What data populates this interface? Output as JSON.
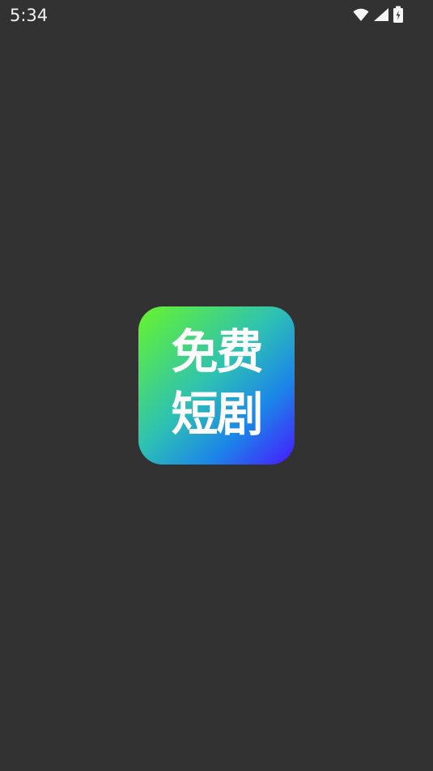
{
  "status_bar": {
    "time": "5:34",
    "icons": [
      "wifi-icon",
      "signal-icon",
      "battery-icon"
    ]
  },
  "app": {
    "icon_line_1": "免费",
    "icon_line_2": "短剧"
  },
  "colors": {
    "background": "#323232",
    "status_text": "#f2f2f2",
    "gradient": [
      "#67f52a",
      "#2ec1b3",
      "#1c86e8",
      "#4618ff"
    ],
    "icon_text": "#fbfbfb"
  }
}
